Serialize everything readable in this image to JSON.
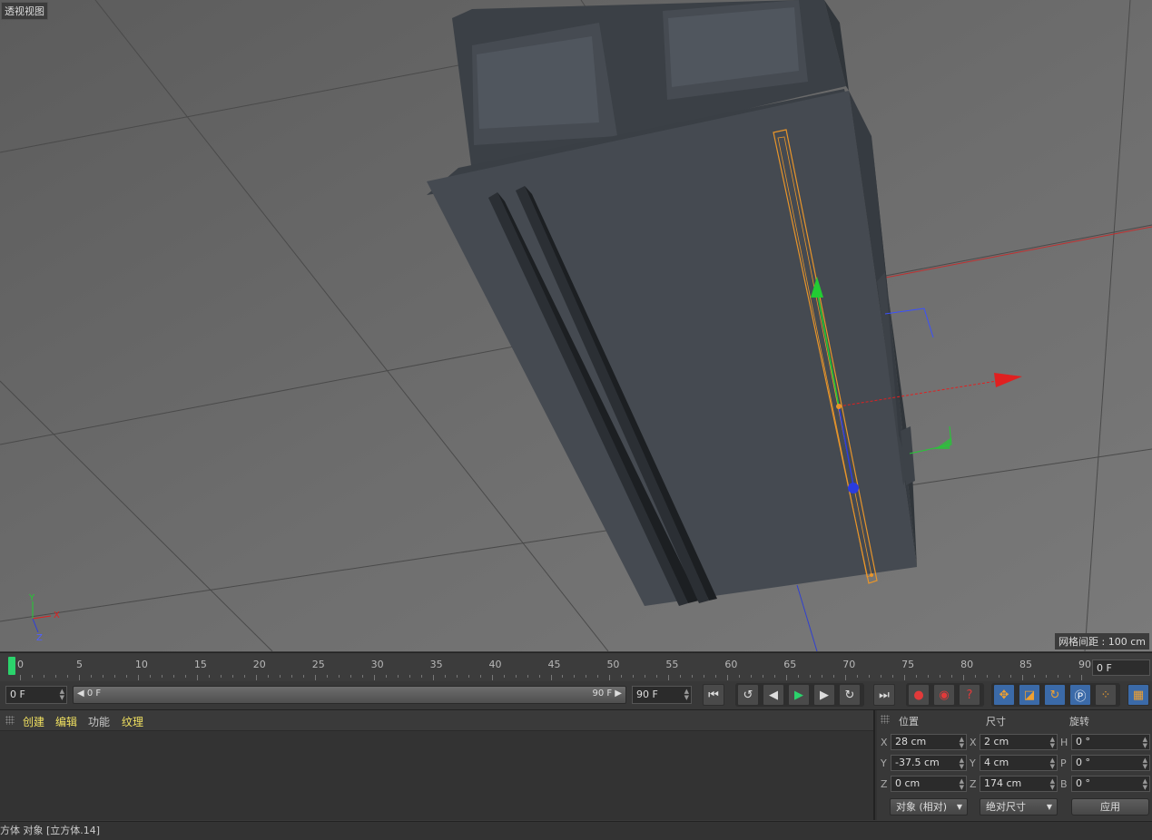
{
  "viewport": {
    "label": "透视视图",
    "grid_spacing": "网格间距 : 100 cm",
    "axis_gizmo": {
      "y": "Y",
      "x": "X",
      "z": "Z"
    }
  },
  "timeline": {
    "ticks": [
      "0",
      "5",
      "10",
      "15",
      "20",
      "25",
      "30",
      "35",
      "40",
      "45",
      "50",
      "55",
      "60",
      "65",
      "70",
      "75",
      "80",
      "85",
      "90"
    ],
    "current_frame_field": "0 F"
  },
  "controls": {
    "start_field": "0 F",
    "range_start": "◀ 0 F",
    "range_end": "90 F ▶",
    "end_field": "90 F"
  },
  "material_panel": {
    "menu": [
      "创建",
      "编辑",
      "功能",
      "纹理"
    ]
  },
  "coordinates": {
    "headers": {
      "position": "位置",
      "size": "尺寸",
      "rotation": "旋转"
    },
    "position": {
      "x": "28 cm",
      "y": "-37.5 cm",
      "z": "0 cm"
    },
    "size": {
      "x": "2 cm",
      "y": "4 cm",
      "z": "174 cm"
    },
    "rotation": {
      "h": "0 °",
      "p": "0 °",
      "b": "0 °"
    },
    "axis_labels": {
      "x": "X",
      "y": "Y",
      "z": "Z",
      "h": "H",
      "p": "P",
      "b": "B"
    },
    "mode_dropdown": "对象 (相对)",
    "size_dropdown": "绝对尺寸",
    "apply_label": "应用"
  },
  "status": {
    "text": "方体 对象 [立方体.14]"
  },
  "colors": {
    "accent_green": "#2bd36c",
    "selection_orange": "#e8952a",
    "axis_red": "#e02020",
    "axis_green": "#22cc33",
    "axis_blue": "#2a3ce0"
  }
}
